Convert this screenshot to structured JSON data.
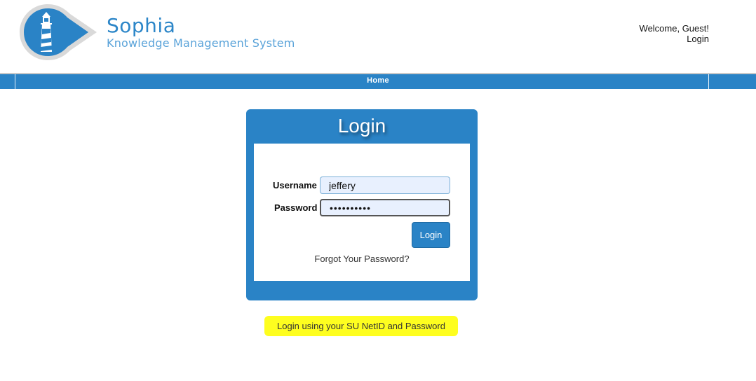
{
  "brand": {
    "name": "Sophia",
    "subtitle": "Knowledge Management System",
    "logo_icon": "lighthouse-logo-icon"
  },
  "user_menu": {
    "welcome": "Welcome, Guest!",
    "login_link": "Login"
  },
  "nav": {
    "home": "Home"
  },
  "login_panel": {
    "title": "Login",
    "username_label": "Username",
    "username_value": "jeffery",
    "password_label": "Password",
    "password_value": "••••••••••",
    "submit_label": "Login",
    "forgot_link": "Forgot Your Password?"
  },
  "hint": "Login using your SU NetID and Password",
  "colors": {
    "primary_blue": "#2a83c6",
    "highlight_yellow": "#fefe1f",
    "input_fill": "#e8f0fe"
  }
}
